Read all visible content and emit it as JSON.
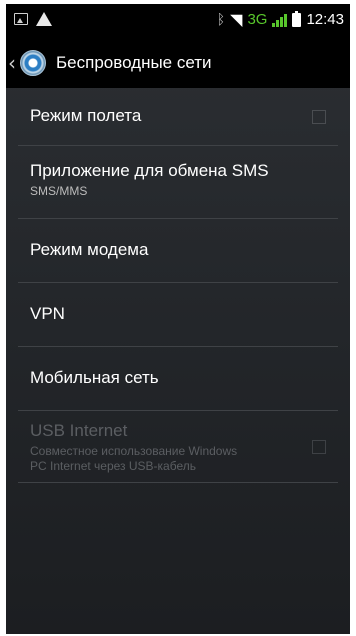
{
  "status_bar": {
    "time": "12:43",
    "network_type": "3G",
    "icons": [
      "image-notification-icon",
      "warning-icon",
      "bluetooth-icon",
      "wifi-icon",
      "signal-icon",
      "battery-icon"
    ]
  },
  "action_bar": {
    "back_icon": "chevron-left-icon",
    "app_icon": "settings-gear-icon",
    "title": "Беспроводные сети"
  },
  "items": [
    {
      "title": "Режим полета",
      "summary": "",
      "checkbox": true,
      "checked": false,
      "enabled": true
    },
    {
      "title": "Приложение для обмена SMS",
      "summary": "SMS/MMS",
      "checkbox": false,
      "enabled": true
    },
    {
      "title": "Режим модема",
      "summary": "",
      "checkbox": false,
      "enabled": true
    },
    {
      "title": "VPN",
      "summary": "",
      "checkbox": false,
      "enabled": true
    },
    {
      "title": "Мобильная сеть",
      "summary": "",
      "checkbox": false,
      "enabled": true
    },
    {
      "title": "USB Internet",
      "summary_line1": "Совместное использование Windows",
      "summary_line2": "PC Internet через USB-кабель",
      "checkbox": true,
      "checked": false,
      "enabled": false
    }
  ],
  "colors": {
    "background_top": "#2c2f33",
    "background_bottom": "#1c1e21",
    "divider": "#3f4246",
    "network_green": "#58c72c",
    "disabled_text": "#5b5e62"
  }
}
